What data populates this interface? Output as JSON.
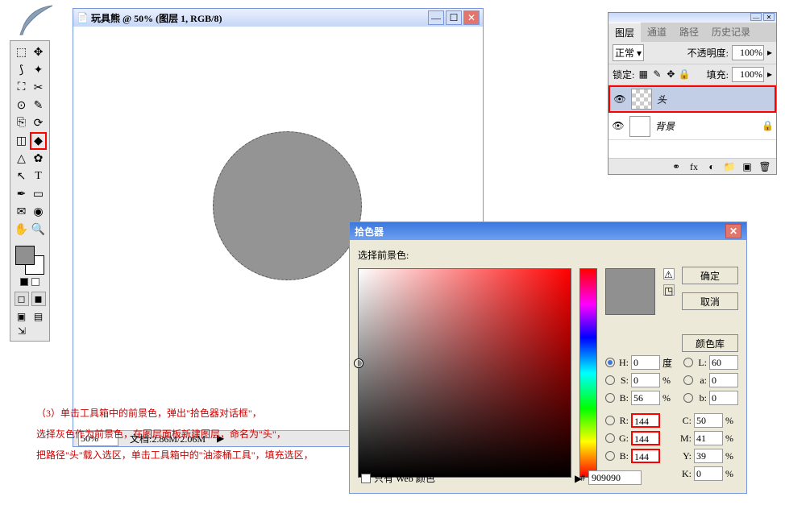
{
  "logo_alt": "Feather",
  "toolbox": {
    "tools": [
      [
        "▭",
        "➔"
      ],
      [
        "⬚",
        "✂"
      ],
      [
        "✎",
        "✚"
      ],
      [
        "✐",
        "⌫"
      ],
      [
        "⎘",
        "⟳"
      ],
      [
        "⌫",
        "⛆"
      ],
      [
        "△",
        "✿"
      ],
      [
        "◜",
        "T"
      ],
      [
        "✎",
        "⬠"
      ],
      [
        "☝",
        "◉"
      ],
      [
        "⤧",
        "✋"
      ]
    ]
  },
  "swatches": {
    "fg": "#909090",
    "bg": "#ffffff"
  },
  "doc": {
    "title": "玩具熊 @ 50% (图层 1, RGB/8)",
    "zoom": "50%",
    "mem_label": "文档:",
    "mem": "2.86M/2.06M"
  },
  "layers": {
    "tabs": [
      "图层",
      "通道",
      "路径",
      "历史记录"
    ],
    "blend_mode": "正常",
    "opacity_label": "不透明度:",
    "opacity": "100%",
    "lock_label": "锁定:",
    "fill_label": "填充:",
    "fill": "100%",
    "items": [
      {
        "name": "头",
        "visible": true,
        "selected": true,
        "has_thumb": true,
        "checker": true
      },
      {
        "name": "背景",
        "visible": true,
        "selected": false,
        "has_thumb": true,
        "checker": false,
        "locked": true
      }
    ]
  },
  "picker": {
    "title": "拾色器",
    "prompt": "选择前景色:",
    "ok": "确定",
    "cancel": "取消",
    "lib": "颜色库",
    "web_only_label": "只有 Web 颜色",
    "hex_label": "#",
    "hex": "909090",
    "fields": {
      "H": {
        "v": "0",
        "u": "度"
      },
      "S": {
        "v": "0",
        "u": "%"
      },
      "Bhsb": {
        "v": "56",
        "u": "%"
      },
      "R": {
        "v": "144"
      },
      "G": {
        "v": "144"
      },
      "Brgb": {
        "v": "144"
      },
      "L": {
        "v": "60"
      },
      "a": {
        "v": "0"
      },
      "b": {
        "v": "0"
      },
      "C": {
        "v": "50",
        "u": "%"
      },
      "M": {
        "v": "41",
        "u": "%"
      },
      "Y": {
        "v": "39",
        "u": "%"
      },
      "K": {
        "v": "0",
        "u": "%"
      }
    }
  },
  "instructions": {
    "line1": "（3）单击工具箱中的前景色，弹出\"拾色器对话框\"，",
    "line2": "选择灰色作为前景色，在图层面板新建图层，命名为\"头\"，",
    "line3": "把路径\"头\"载入选区，单击工具箱中的\"油漆桶工具\"，填充选区，"
  }
}
